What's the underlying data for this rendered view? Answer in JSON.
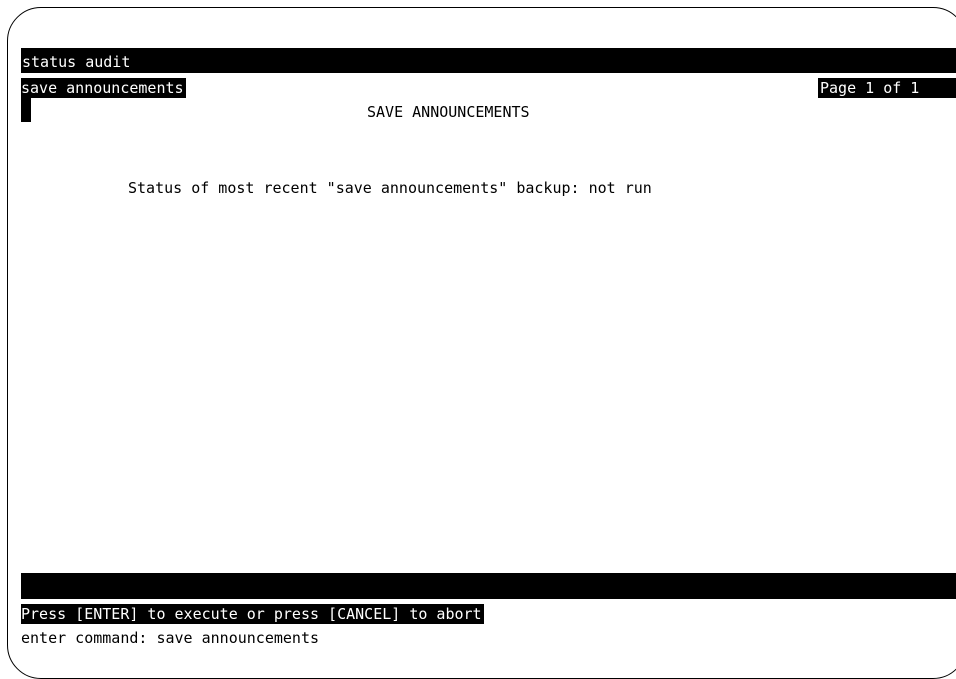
{
  "header": {
    "command_line": "status audit",
    "form_name": "save announcements",
    "page_indicator": "Page 1 of 1",
    "title": "SAVE ANNOUNCEMENTS"
  },
  "main": {
    "status_line": "Status of most recent \"save announcements\" backup: not run"
  },
  "footer": {
    "prompt": "Press [ENTER] to execute or press [CANCEL] to abort",
    "command_entry": "enter command: save announcements"
  }
}
